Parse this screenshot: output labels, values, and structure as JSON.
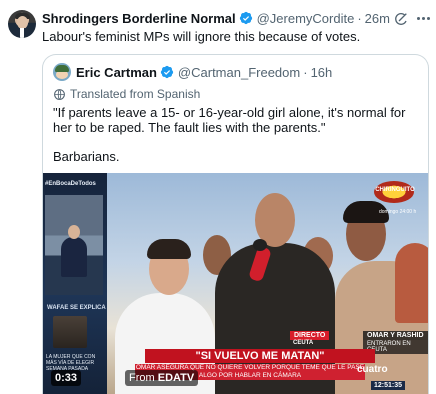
{
  "tweet": {
    "author_name": "Shrodingers Borderline Normal",
    "handle": "@JeremyCordite",
    "separator": "·",
    "time": "26m",
    "text": "Labour's feminist MPs will ignore this because of votes."
  },
  "quoted_tweet": {
    "author_name": "Eric Cartman",
    "handle": "@Cartman_Freedom",
    "separator": "·",
    "time": "16h",
    "translated_label": "Translated from Spanish",
    "text_paragraph_1": "\"If parents leave a 15- or 16-year-old girl alone, it's normal for her to be raped. The fault lies with the parents.\"",
    "text_paragraph_2": "Barbarians."
  },
  "video": {
    "duration": "0:33",
    "from_label": "From",
    "source_name": "EDATV",
    "studio_tag": "#EnBocaDeTodos",
    "wafae_tag": "WAFAE SE EXPLICA",
    "inset_caption": "LA MUJER QUE CON MÁS VÍA DE ELEGIR SEMANA PASADA",
    "logo_text": "CHIRINGUITO",
    "sponsor_text": "domingo 24:00 h",
    "directo_label": "DIRECTO",
    "location": "CEUTA",
    "names_label": "OMAR Y RASHID",
    "names_sub": "ENTRARON EN CEUTA",
    "headline": "\"SI VUELVO ME MATAN\"",
    "subheadline": "OMAR ASEGURA QUE NO QUIERE VOLVER PORQUE TEME QUE LE PASE ALGO POR HABLAR EN CÁMARA",
    "channel": "cuatro",
    "clock": "12:51:35"
  },
  "icons": {
    "verified": "verified-badge-icon",
    "grok": "grok-icon",
    "more": "more-icon",
    "translate": "globe-icon"
  },
  "colors": {
    "verified_blue": "#1d9bf0",
    "secondary_text": "#536471",
    "border": "#cfd9de",
    "banner_red": "#c1121f"
  }
}
